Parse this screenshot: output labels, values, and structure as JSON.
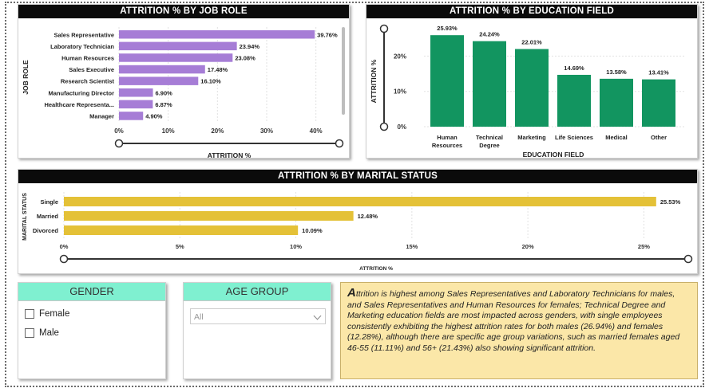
{
  "colors": {
    "job": "#a67dd6",
    "education": "#129560",
    "marital": "#e4c137",
    "slicer_header": "#7ff0d0",
    "insight_bg": "#fbe7a8"
  },
  "chart_data": [
    {
      "id": "job_role",
      "type": "bar",
      "orientation": "horizontal",
      "title": "ATTRITION % BY JOB ROLE",
      "xlabel": "ATTRITION %",
      "ylabel": "JOB ROLE",
      "categories": [
        "Sales Representative",
        "Laboratory Technician",
        "Human Resources",
        "Sales Executive",
        "Research Scientist",
        "Manufacturing Director",
        "Healthcare Representa...",
        "Manager"
      ],
      "values": [
        39.76,
        23.94,
        23.08,
        17.48,
        16.1,
        6.9,
        6.87,
        4.9
      ],
      "value_labels": [
        "39.76%",
        "23.94%",
        "23.08%",
        "17.48%",
        "16.10%",
        "6.90%",
        "6.87%",
        "4.90%"
      ],
      "xlim": [
        0,
        42
      ],
      "ticks": [
        0,
        10,
        20,
        30,
        40
      ],
      "tick_labels": [
        "0%",
        "10%",
        "20%",
        "30%",
        "40%"
      ]
    },
    {
      "id": "education_field",
      "type": "bar",
      "orientation": "vertical",
      "title": "ATTRITION % BY EDUCATION FIELD",
      "xlabel": "EDUCATION FIELD",
      "ylabel": "ATTRITION %",
      "categories": [
        [
          "Human",
          "Resources"
        ],
        [
          "Technical",
          "Degree"
        ],
        [
          "Marketing"
        ],
        [
          "Life Sciences"
        ],
        [
          "Medical"
        ],
        [
          "Other"
        ]
      ],
      "values": [
        25.93,
        24.24,
        22.01,
        14.69,
        13.58,
        13.41
      ],
      "value_labels": [
        "25.93%",
        "24.24%",
        "22.01%",
        "14.69%",
        "13.58%",
        "13.41%"
      ],
      "ylim": [
        0,
        28
      ],
      "ticks": [
        0,
        10,
        20
      ],
      "tick_labels": [
        "0%",
        "10%",
        "20%"
      ]
    },
    {
      "id": "marital_status",
      "type": "bar",
      "orientation": "horizontal",
      "title": "ATTRITION % BY MARITAL STATUS",
      "xlabel": "ATTRITION %",
      "ylabel": "MARITAL STATUS",
      "categories": [
        "Single",
        "Married",
        "Divorced"
      ],
      "values": [
        25.53,
        12.48,
        10.09
      ],
      "value_labels": [
        "25.53%",
        "12.48%",
        "10.09%"
      ],
      "xlim": [
        0,
        26.5
      ],
      "ticks": [
        0,
        5,
        10,
        15,
        20,
        25
      ],
      "tick_labels": [
        "0%",
        "5%",
        "10%",
        "15%",
        "20%",
        "25%"
      ]
    }
  ],
  "gender_slicer": {
    "title": "GENDER",
    "options": [
      "Female",
      "Male"
    ]
  },
  "age_slicer": {
    "title": "AGE GROUP",
    "selected": "All"
  },
  "insight": {
    "dropcap": "A",
    "text": "ttrition is highest among Sales Representatives and Laboratory Technicians for males, and Sales Representatives and Human Resources for females; Technical Degree and Marketing education fields are most impacted across genders, with single employees consistently exhibiting the highest attrition rates for both males (26.94%) and females (12.28%), although there are specific age group variations, such as married females aged 46-55 (11.11%) and 56+ (21.43%) also showing significant attrition."
  }
}
